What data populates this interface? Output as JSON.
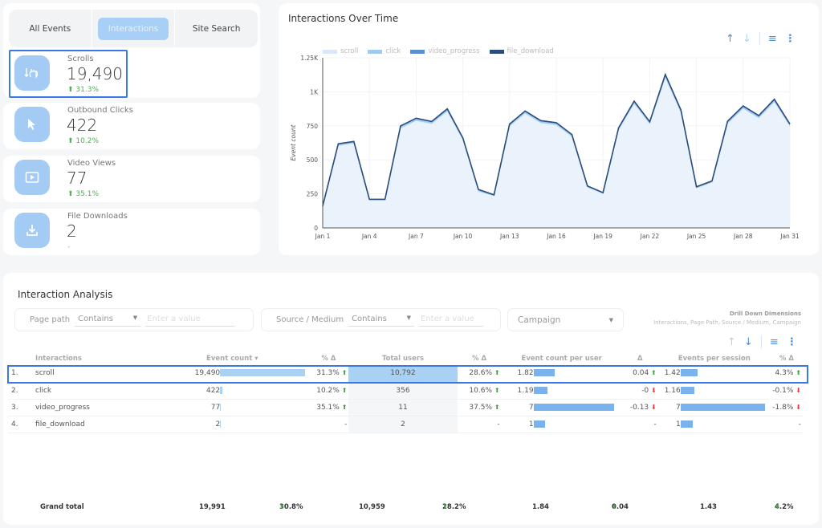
{
  "tabs": [
    {
      "label": "All Events",
      "active": false
    },
    {
      "label": "Interactions",
      "active": true
    },
    {
      "label": "Site Search",
      "active": false
    }
  ],
  "kpis": [
    {
      "icon": "scroll-hand-icon",
      "label": "Scrolls",
      "value": "19,490",
      "delta": "31.3%",
      "trend": "up"
    },
    {
      "icon": "cursor-pointer-icon",
      "label": "Outbound Clicks",
      "value": "422",
      "delta": "10.2%",
      "trend": "up"
    },
    {
      "icon": "video-play-icon",
      "label": "Video Views",
      "value": "77",
      "delta": "35.1%",
      "trend": "up"
    },
    {
      "icon": "download-icon",
      "label": "File Downloads",
      "value": "2",
      "delta": "-",
      "trend": "none"
    }
  ],
  "chart_panel": {
    "title": "Interactions Over Time",
    "toolbar": {
      "sort_asc": "↑",
      "sort_desc": "↓",
      "filter": "≡",
      "more": "⋮"
    }
  },
  "chart_data": {
    "type": "area",
    "title": "Interactions Over Time",
    "xlabel": "",
    "ylabel": "Event count",
    "ylim": [
      0,
      1250
    ],
    "yticks": [
      0,
      250,
      500,
      750,
      1000,
      1250
    ],
    "ytick_labels": [
      "0",
      "250",
      "500",
      "750",
      "1K",
      "1.25K"
    ],
    "xtick_labels": [
      "Jan 1",
      "Jan 4",
      "Jan 7",
      "Jan 10",
      "Jan 13",
      "Jan 16",
      "Jan 19",
      "Jan 22",
      "Jan 25",
      "Jan 28",
      "Jan 31"
    ],
    "grid": true,
    "stacked": true,
    "legend_position": "top-left",
    "x": [
      "Jan 1",
      "Jan 2",
      "Jan 3",
      "Jan 4",
      "Jan 5",
      "Jan 6",
      "Jan 7",
      "Jan 8",
      "Jan 9",
      "Jan 10",
      "Jan 11",
      "Jan 12",
      "Jan 13",
      "Jan 14",
      "Jan 15",
      "Jan 16",
      "Jan 17",
      "Jan 18",
      "Jan 19",
      "Jan 20",
      "Jan 21",
      "Jan 22",
      "Jan 23",
      "Jan 24",
      "Jan 25",
      "Jan 26",
      "Jan 27",
      "Jan 28",
      "Jan 29",
      "Jan 30",
      "Jan 31"
    ],
    "series": [
      {
        "name": "scroll",
        "color": "#d6e8fa",
        "values": [
          155,
          605,
          622,
          203,
          203,
          733,
          788,
          766,
          857,
          647,
          268,
          235,
          747,
          842,
          772,
          757,
          672,
          299,
          251,
          720,
          913,
          764,
          1104,
          848,
          292,
          335,
          767,
          877,
          808,
          926,
          747
        ]
      },
      {
        "name": "click",
        "color": "#9fcbf1",
        "values": [
          5,
          11,
          11,
          6,
          6,
          13,
          15,
          13,
          15,
          12,
          12,
          7,
          13,
          14,
          13,
          13,
          12,
          8,
          7,
          13,
          15,
          13,
          19,
          15,
          8,
          8,
          14,
          16,
          14,
          16,
          13
        ]
      },
      {
        "name": "video_progress",
        "color": "#5b8fcf",
        "values": [
          1,
          2,
          2,
          1,
          1,
          3,
          3,
          3,
          3,
          2,
          2,
          1,
          3,
          3,
          3,
          3,
          2,
          1,
          1,
          2,
          3,
          3,
          4,
          4,
          2,
          2,
          3,
          3,
          3,
          3,
          3
        ]
      },
      {
        "name": "file_download",
        "color": "#2c4d7c",
        "values": [
          0,
          0,
          0,
          0,
          0,
          0,
          0,
          0,
          0,
          0,
          0,
          0,
          0,
          0,
          0,
          0,
          0,
          0,
          0,
          0,
          0,
          0,
          0,
          0,
          0,
          0,
          0,
          0,
          0,
          0,
          0
        ]
      }
    ],
    "totals": [
      161,
      618,
      635,
      210,
      210,
      749,
      806,
      782,
      875,
      661,
      282,
      243,
      763,
      859,
      788,
      773,
      686,
      308,
      259,
      735,
      931,
      780,
      1127,
      867,
      302,
      345,
      784,
      896,
      825,
      945,
      763
    ]
  },
  "table_panel": {
    "title": "Interaction Analysis",
    "filters": [
      {
        "label": "Page path",
        "operator": "Contains",
        "placeholder": "Enter a value"
      },
      {
        "label": "Source / Medium",
        "operator": "Contains",
        "placeholder": "Enter a value"
      }
    ],
    "campaign_select": "Campaign",
    "drill_title": "Drill Down Dimensions",
    "drill_sub": "Interactions, Page Path, Source / Medium, Campaign",
    "columns": [
      "Interactions",
      "Event count ▾",
      "% Δ",
      "Total users",
      "% Δ",
      "Event count per user",
      "Δ",
      "Events per session",
      "% Δ"
    ],
    "rows": [
      {
        "idx": "1.",
        "name": "scroll",
        "events": "19,490",
        "events_frac": 1.0,
        "events_delta": "31.3%",
        "events_trend": "up",
        "users": "10,792",
        "users_delta": "28.6%",
        "users_trend": "up",
        "ecpu": "1.82",
        "ecpu_frac": 0.26,
        "ecpu_delta": "0.04",
        "ecpu_trend": "up",
        "eps": "1.42",
        "eps_frac": 0.2,
        "eps_delta": "4.3%",
        "eps_trend": "up"
      },
      {
        "idx": "2.",
        "name": "click",
        "events": "422",
        "events_frac": 0.022,
        "events_delta": "10.2%",
        "events_trend": "up",
        "users": "356",
        "users_delta": "10.6%",
        "users_trend": "up",
        "ecpu": "1.19",
        "ecpu_frac": 0.17,
        "ecpu_delta": "-0",
        "ecpu_trend": "down",
        "eps": "1.16",
        "eps_frac": 0.166,
        "eps_delta": "-0.1%",
        "eps_trend": "down"
      },
      {
        "idx": "3.",
        "name": "video_progress",
        "events": "77",
        "events_frac": 0.004,
        "events_delta": "35.1%",
        "events_trend": "up",
        "users": "11",
        "users_delta": "37.5%",
        "users_trend": "up",
        "ecpu": "7",
        "ecpu_frac": 1.0,
        "ecpu_delta": "-0.13",
        "ecpu_trend": "down",
        "eps": "7",
        "eps_frac": 1.0,
        "eps_delta": "-1.8%",
        "eps_trend": "down"
      },
      {
        "idx": "4.",
        "name": "file_download",
        "events": "2",
        "events_frac": 0.001,
        "events_delta": "-",
        "events_trend": "none",
        "users": "2",
        "users_delta": "-",
        "users_trend": "none",
        "ecpu": "1",
        "ecpu_frac": 0.143,
        "ecpu_delta": "-",
        "ecpu_trend": "none",
        "eps": "1",
        "eps_frac": 0.143,
        "eps_delta": "-",
        "eps_trend": "none"
      }
    ],
    "grand_total": {
      "label": "Grand total",
      "events": "19,991",
      "events_delta": "30.8%",
      "users": "10,959",
      "users_delta": "28.2%",
      "ecpu": "1.84",
      "ecpu_delta": "0.04",
      "eps": "1.43",
      "eps_delta": "4.2%"
    },
    "arrow_up": "⬆",
    "arrow_down": "⬇"
  }
}
